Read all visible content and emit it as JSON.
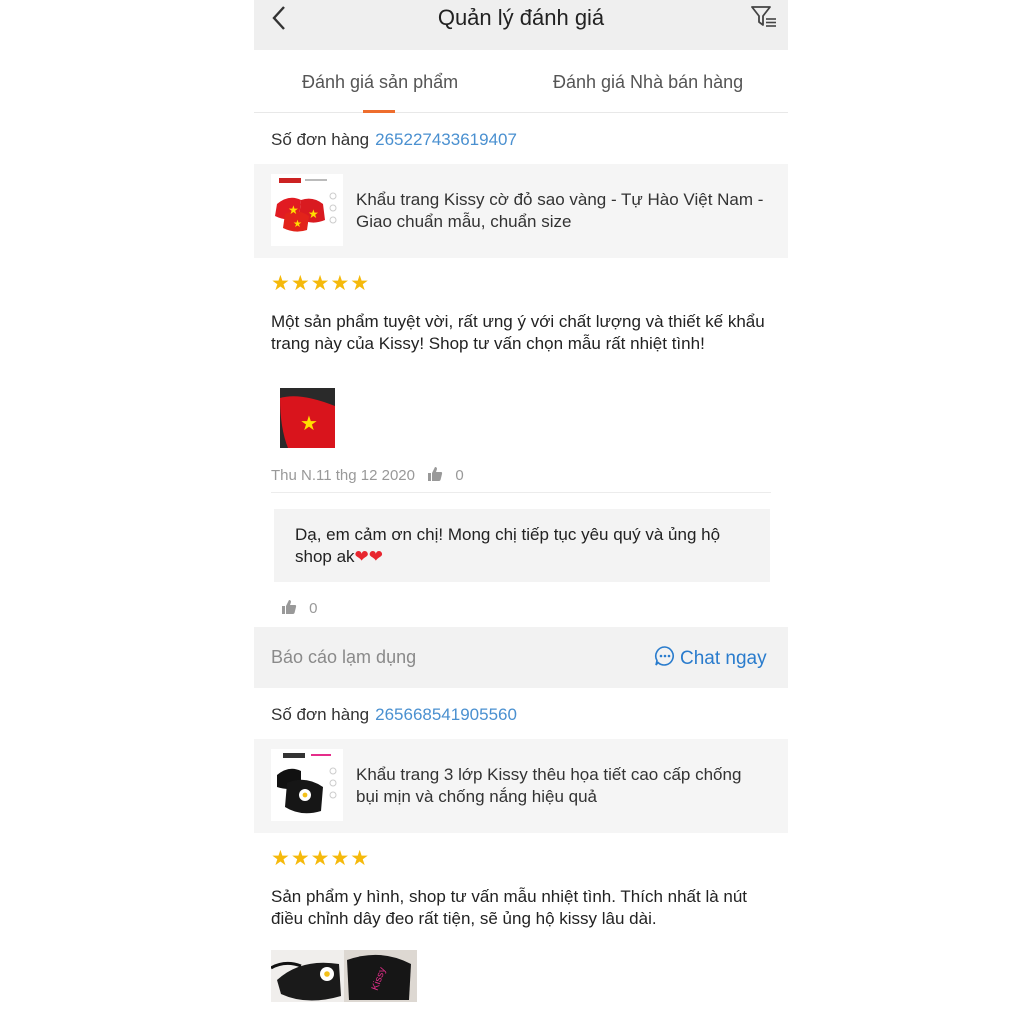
{
  "header": {
    "title": "Quản lý đánh giá"
  },
  "tabs": [
    {
      "label": "Đánh giá sản phẩm",
      "active": true
    },
    {
      "label": "Đánh giá Nhà bán hàng",
      "active": false
    }
  ],
  "order_label": "Số đơn hàng",
  "reviews": [
    {
      "order_number": "265227433619407",
      "product_name": "Khẩu trang Kissy cờ đỏ sao vàng - Tự Hào Việt Nam - Giao chuẩn mẫu, chuẩn size",
      "rating": 5,
      "stars": "★★★★★",
      "text": "Một sản phẩm tuyệt vời, rất ưng ý với chất lượng và thiết kế khẩu trang này của Kissy! Shop tư vấn chọn mẫu rất nhiệt tình!",
      "date": "Thu N.11 thg 12 2020",
      "likes": "0",
      "reply": {
        "text": "Dạ, em cảm ơn chị! Mong chị tiếp tục yêu quý và ủng hộ shop ak",
        "hearts": "❤❤",
        "likes": "0"
      }
    },
    {
      "order_number": "265668541905560",
      "product_name": "Khẩu trang 3 lớp Kissy thêu họa tiết cao cấp chống bụi mịn và chống nắng hiệu quả",
      "rating": 5,
      "stars": "★★★★★",
      "text": "Sản phẩm y hình, shop tư vấn mẫu nhiệt tình. Thích nhất là nút điều chỉnh dây đeo rất tiện, sẽ ủng hộ kissy lâu dài."
    }
  ],
  "actions": {
    "report": "Báo cáo lạm dụng",
    "chat": "Chat ngay"
  },
  "colors": {
    "accent": "#ee6d2d",
    "link": "#4a90d0",
    "chat": "#2a7ccd",
    "star": "#f5b90b"
  },
  "icons": [
    "back-arrow-icon",
    "filter-icon",
    "thumbs-up-icon",
    "chat-bubble-icon",
    "star-icon"
  ]
}
